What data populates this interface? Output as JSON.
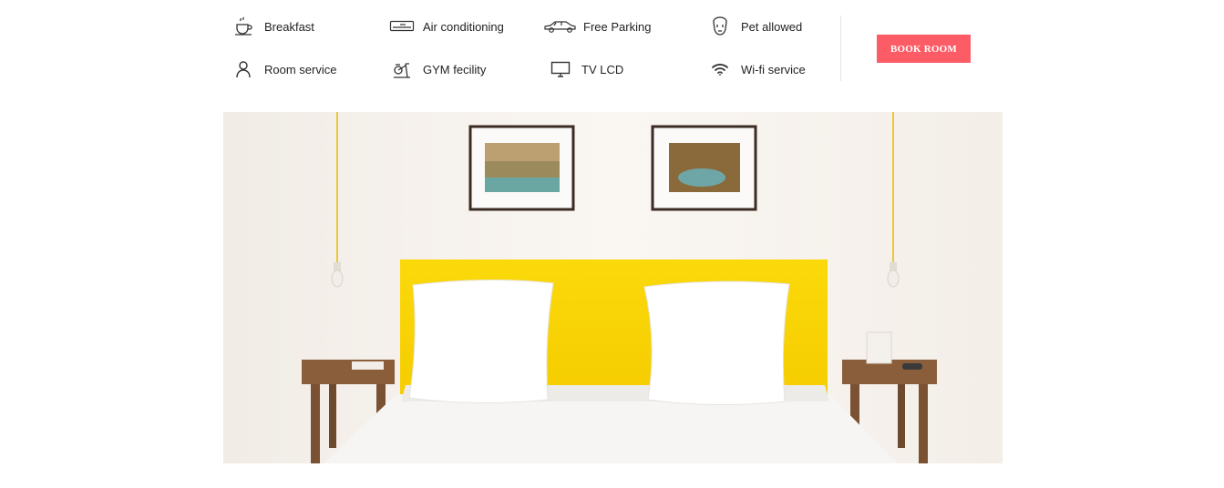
{
  "amenities": [
    {
      "label": "Breakfast",
      "icon": "coffee-cup-icon"
    },
    {
      "label": "Air conditioning",
      "icon": "air-conditioner-icon"
    },
    {
      "label": "Free Parking",
      "icon": "car-icon"
    },
    {
      "label": "Pet allowed",
      "icon": "pet-icon"
    },
    {
      "label": "Room service",
      "icon": "person-icon"
    },
    {
      "label": "GYM fecility",
      "icon": "exercise-bike-icon"
    },
    {
      "label": "TV LCD",
      "icon": "monitor-icon"
    },
    {
      "label": "Wi-fi service",
      "icon": "wifi-icon"
    }
  ],
  "book_button": {
    "label": "BOOK ROOM"
  },
  "room_image": {
    "subject": "hotel bedroom with yellow headboard"
  },
  "colors": {
    "accent": "#fc5c65",
    "headboard": "#f7d205",
    "icon": "#333333"
  }
}
